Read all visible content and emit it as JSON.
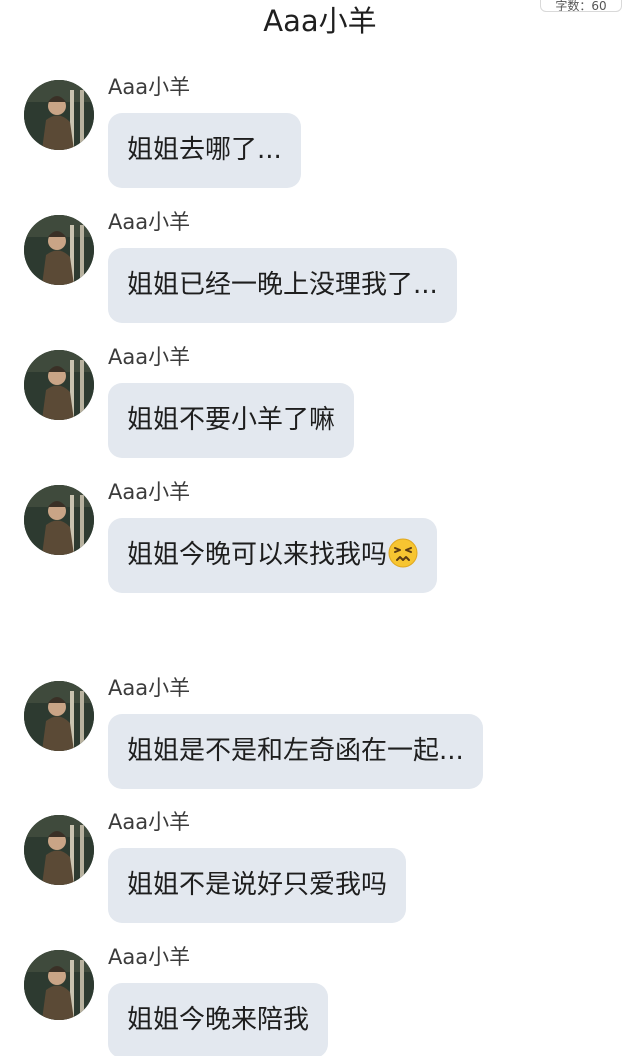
{
  "header": {
    "title": "Aaa小羊",
    "corner_badge": "字数：60"
  },
  "messages": [
    {
      "sender": "Aaa小羊",
      "text": "姐姐去哪了..."
    },
    {
      "sender": "Aaa小羊",
      "text": "姐姐已经一晚上没理我了..."
    },
    {
      "sender": "Aaa小羊",
      "text": "姐姐不要小羊了嘛"
    },
    {
      "sender": "Aaa小羊",
      "text": "姐姐今晚可以来找我吗",
      "emoji": "persevering-face-emoji"
    },
    {
      "sender": "Aaa小羊",
      "text": "姐姐是不是和左奇函在一起..."
    },
    {
      "sender": "Aaa小羊",
      "text": "姐姐不是说好只爱我吗"
    },
    {
      "sender": "Aaa小羊",
      "text": "姐姐今晚来陪我"
    }
  ],
  "colors": {
    "bubble": "#e3e8ef",
    "text": "#1e1e1e",
    "emoji": "#f7c531"
  }
}
